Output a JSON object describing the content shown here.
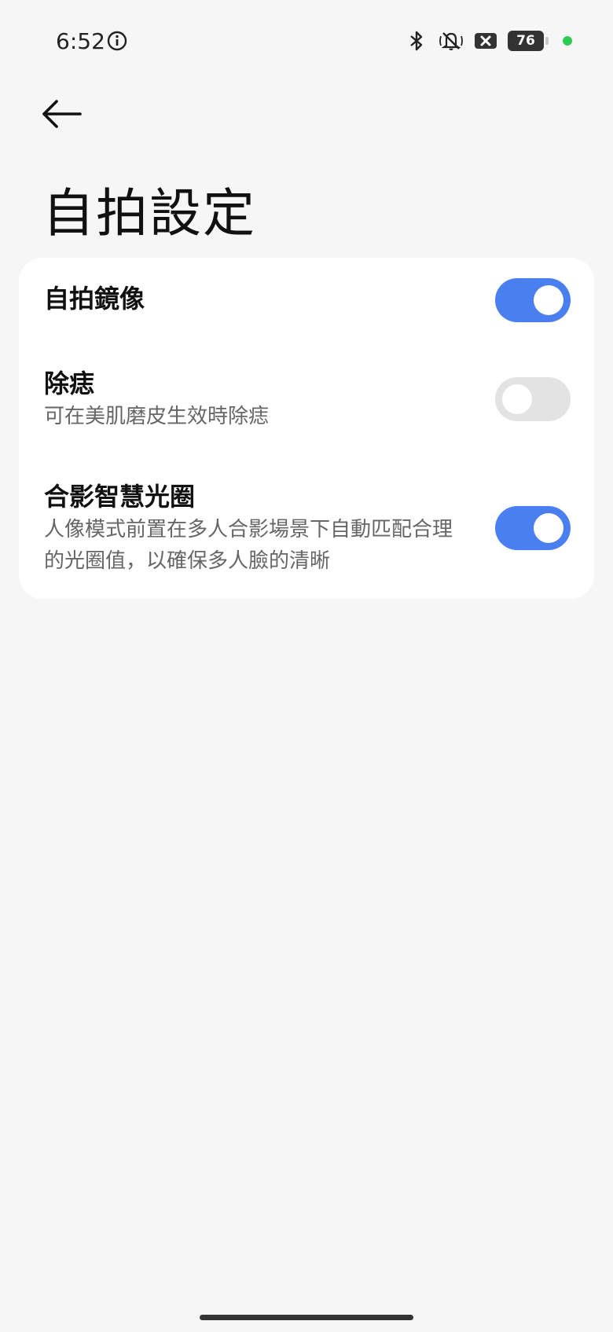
{
  "status_bar": {
    "time": "6:52",
    "battery_level": "76",
    "icons": [
      "info-icon",
      "bluetooth-icon",
      "muted-bell-icon",
      "no-sim-icon",
      "battery-icon",
      "privacy-dot-icon"
    ],
    "privacy_dot_color": "#2ecc54"
  },
  "header": {
    "back_icon": "arrow-left-icon",
    "title": "自拍設定"
  },
  "settings": [
    {
      "title": "自拍鏡像",
      "description": "",
      "enabled": true
    },
    {
      "title": "除痣",
      "description": "可在美肌磨皮生效時除痣",
      "enabled": false
    },
    {
      "title": "合影智慧光圈",
      "description_line1": "人像模式前置在多人合影場景下自動匹配合理",
      "description_line2": "的光圈值，以確保多人臉的清晰",
      "enabled": true
    }
  ],
  "colors": {
    "accent": "#4a7ff0",
    "toggle_off": "#e3e3e3",
    "background": "#f6f6f6",
    "card": "#ffffff"
  }
}
